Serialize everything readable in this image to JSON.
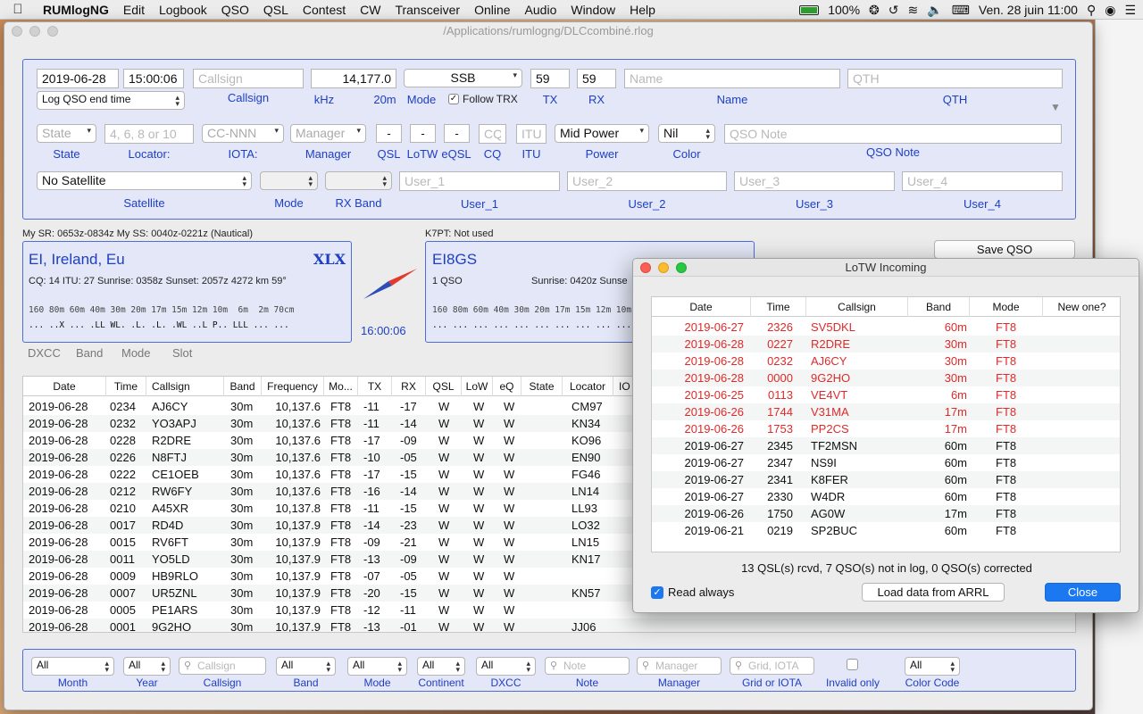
{
  "menubar": {
    "app_name": "RUMlogNG",
    "items": [
      "Edit",
      "Logbook",
      "QSO",
      "QSL",
      "Contest",
      "CW",
      "Transceiver",
      "Online",
      "Audio",
      "Window",
      "Help"
    ],
    "battery": "100%",
    "datetime": "Ven. 28 juin  11:00"
  },
  "window": {
    "title": "/Applications/rumlogng/DLCcombiné.rlog"
  },
  "entry": {
    "date": "2019-06-28",
    "time": "15:00:06",
    "callsign_placeholder": "Callsign",
    "frequency": "14,177.0",
    "mode": "SSB",
    "tx": "59",
    "rx": "59",
    "name_placeholder": "Name",
    "qth_placeholder": "QTH",
    "log_end_time": "Log QSO end time",
    "follow_trx": "Follow TRX",
    "labels": {
      "callsign": "Callsign",
      "khz": "kHz",
      "band": "20m",
      "mode": "Mode",
      "tx": "TX",
      "rx": "RX",
      "name": "Name",
      "qth": "QTH"
    },
    "state_placeholder": "State",
    "locator_placeholder": "4, 6, 8 or 10",
    "iota_placeholder": "CC-NNN",
    "manager_placeholder": "Manager",
    "qsl": "-",
    "lotw": "-",
    "eqsl": "-",
    "cq_placeholder": "CQ",
    "itu_placeholder": "ITU",
    "power": "Mid Power",
    "color": "Nil",
    "note_placeholder": "QSO Note",
    "labels2": {
      "state": "State",
      "locator": "Locator:",
      "iota": "IOTA:",
      "manager": "Manager",
      "qsl": "QSL",
      "lotw": "LoTW",
      "eqsl": "eQSL",
      "cq": "CQ",
      "itu": "ITU",
      "power": "Power",
      "color": "Color",
      "note": "QSO Note"
    },
    "satellite": "No Satellite",
    "user1_placeholder": "User_1",
    "user2_placeholder": "User_2",
    "user3_placeholder": "User_3",
    "user4_placeholder": "User_4",
    "labels3": {
      "satellite": "Satellite",
      "mode": "Mode",
      "rx_band": "RX Band",
      "user1": "User_1",
      "user2": "User_2",
      "user3": "User_3",
      "user4": "User_4"
    }
  },
  "sun": {
    "my_times": "My SR: 0653z-0834z  My SS: 0040z-0221z (Nautical)",
    "k7pt": "K7PT: Not used"
  },
  "dxcc_box": {
    "entity": "EI, Ireland, Eu",
    "prefix": "XLX",
    "details": "CQ: 14  ITU: 27  Sunrise: 0358z  Sunset: 2057z  4272 km  59°",
    "bands": "160 80m 60m 40m 30m 20m 17m 15m 12m 10m  6m  2m 70cm",
    "status": "... ..X ... .LL WL. .L. .L. .WL ..L P.. LLL ... ..."
  },
  "clock": "16:00:06",
  "call_box": {
    "call": "EI8GS",
    "qsos": "1 QSO",
    "sunrise": "Sunrise: 0420z  Sunse",
    "bands": "160 80m 60m 40m 30m 20m 17m 15m 12m 10m  6m  2m 70cm",
    "status": "... ... ... ... ... ... ... ... ... ... ... ... ..."
  },
  "save_button": "Save QSO",
  "tabs": [
    "DXCC",
    "Band",
    "Mode",
    "Slot"
  ],
  "qso_table": {
    "headers": [
      "Date",
      "Time",
      "Callsign",
      "Band",
      "Frequency",
      "Mo...",
      "TX",
      "RX",
      "QSL",
      "LoW",
      "eQ",
      "State",
      "Locator",
      "IO"
    ],
    "rows": [
      [
        "2019-06-28",
        "0234",
        "AJ6CY",
        "30m",
        "10,137.6",
        "FT8",
        "-11",
        "-17",
        "W",
        "W",
        "W",
        "",
        "CM97"
      ],
      [
        "2019-06-28",
        "0232",
        "YO3APJ",
        "30m",
        "10,137.6",
        "FT8",
        "-11",
        "-14",
        "W",
        "W",
        "W",
        "",
        "KN34"
      ],
      [
        "2019-06-28",
        "0228",
        "R2DRE",
        "30m",
        "10,137.6",
        "FT8",
        "-17",
        "-09",
        "W",
        "W",
        "W",
        "",
        "KO96"
      ],
      [
        "2019-06-28",
        "0226",
        "N8FTJ",
        "30m",
        "10,137.6",
        "FT8",
        "-10",
        "-05",
        "W",
        "W",
        "W",
        "",
        "EN90"
      ],
      [
        "2019-06-28",
        "0222",
        "CE1OEB",
        "30m",
        "10,137.6",
        "FT8",
        "-17",
        "-15",
        "W",
        "W",
        "W",
        "",
        "FG46"
      ],
      [
        "2019-06-28",
        "0212",
        "RW6FY",
        "30m",
        "10,137.6",
        "FT8",
        "-16",
        "-14",
        "W",
        "W",
        "W",
        "",
        "LN14"
      ],
      [
        "2019-06-28",
        "0210",
        "A45XR",
        "30m",
        "10,137.8",
        "FT8",
        "-11",
        "-15",
        "W",
        "W",
        "W",
        "",
        "LL93"
      ],
      [
        "2019-06-28",
        "0017",
        "RD4D",
        "30m",
        "10,137.9",
        "FT8",
        "-14",
        "-23",
        "W",
        "W",
        "W",
        "",
        "LO32"
      ],
      [
        "2019-06-28",
        "0015",
        "RV6FT",
        "30m",
        "10,137.9",
        "FT8",
        "-09",
        "-21",
        "W",
        "W",
        "W",
        "",
        "LN15"
      ],
      [
        "2019-06-28",
        "0011",
        "YO5LD",
        "30m",
        "10,137.9",
        "FT8",
        "-13",
        "-09",
        "W",
        "W",
        "W",
        "",
        "KN17"
      ],
      [
        "2019-06-28",
        "0009",
        "HB9RLO",
        "30m",
        "10,137.9",
        "FT8",
        "-07",
        "-05",
        "W",
        "W",
        "W",
        "",
        ""
      ],
      [
        "2019-06-28",
        "0007",
        "UR5ZNL",
        "30m",
        "10,137.9",
        "FT8",
        "-20",
        "-15",
        "W",
        "W",
        "W",
        "",
        "KN57"
      ],
      [
        "2019-06-28",
        "0005",
        "PE1ARS",
        "30m",
        "10,137.9",
        "FT8",
        "-12",
        "-11",
        "W",
        "W",
        "W",
        "",
        ""
      ],
      [
        "2019-06-28",
        "0001",
        "9G2HO",
        "30m",
        "10,137.9",
        "FT8",
        "-13",
        "-01",
        "W",
        "W",
        "W",
        "",
        "JJ06"
      ]
    ]
  },
  "filters": {
    "month": "All",
    "year": "All",
    "callsign_placeholder": "Callsign",
    "band": "All",
    "mode": "All",
    "continent": "All",
    "dxcc": "All",
    "note_placeholder": "Note",
    "manager_placeholder": "Manager",
    "grid_placeholder": "Grid, IOTA",
    "color": "All",
    "labels": {
      "month": "Month",
      "year": "Year",
      "callsign": "Callsign",
      "band": "Band",
      "mode": "Mode",
      "continent": "Continent",
      "dxcc": "DXCC",
      "note": "Note",
      "manager": "Manager",
      "grid": "Grid or IOTA",
      "invalid": "Invalid only",
      "color": "Color Code"
    }
  },
  "lotw_dialog": {
    "title": "LoTW Incoming",
    "headers": [
      "Date",
      "Time",
      "Callsign",
      "Band",
      "Mode",
      "New one?"
    ],
    "rows": [
      {
        "date": "2019-06-27",
        "time": "2326",
        "call": "SV5DKL",
        "band": "60m",
        "mode": "FT8",
        "new": true
      },
      {
        "date": "2019-06-28",
        "time": "0227",
        "call": "R2DRE",
        "band": "30m",
        "mode": "FT8",
        "new": true
      },
      {
        "date": "2019-06-28",
        "time": "0232",
        "call": "AJ6CY",
        "band": "30m",
        "mode": "FT8",
        "new": true
      },
      {
        "date": "2019-06-28",
        "time": "0000",
        "call": "9G2HO",
        "band": "30m",
        "mode": "FT8",
        "new": true
      },
      {
        "date": "2019-06-25",
        "time": "0113",
        "call": "VE4VT",
        "band": "6m",
        "mode": "FT8",
        "new": true
      },
      {
        "date": "2019-06-26",
        "time": "1744",
        "call": "V31MA",
        "band": "17m",
        "mode": "FT8",
        "new": true
      },
      {
        "date": "2019-06-26",
        "time": "1753",
        "call": "PP2CS",
        "band": "17m",
        "mode": "FT8",
        "new": true
      },
      {
        "date": "2019-06-27",
        "time": "2345",
        "call": "TF2MSN",
        "band": "60m",
        "mode": "FT8",
        "new": false
      },
      {
        "date": "2019-06-27",
        "time": "2347",
        "call": "NS9I",
        "band": "60m",
        "mode": "FT8",
        "new": false
      },
      {
        "date": "2019-06-27",
        "time": "2341",
        "call": "K8FER",
        "band": "60m",
        "mode": "FT8",
        "new": false
      },
      {
        "date": "2019-06-27",
        "time": "2330",
        "call": "W4DR",
        "band": "60m",
        "mode": "FT8",
        "new": false
      },
      {
        "date": "2019-06-26",
        "time": "1750",
        "call": "AG0W",
        "band": "17m",
        "mode": "FT8",
        "new": false
      },
      {
        "date": "2019-06-21",
        "time": "0219",
        "call": "SP2BUC",
        "band": "60m",
        "mode": "FT8",
        "new": false
      }
    ],
    "summary": "13 QSL(s) rcvd, 7 QSO(s) not in log, 0 QSO(s) corrected",
    "read_always": "Read always",
    "load_button": "Load data from ARRL",
    "close_button": "Close",
    "colors": {
      "new": "#e02a2a",
      "accent": "#1c78f0"
    }
  }
}
